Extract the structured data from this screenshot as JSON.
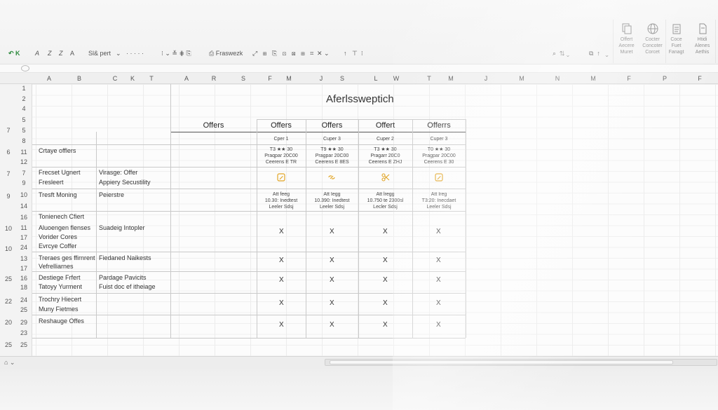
{
  "ribbon": {
    "groups": [
      {
        "label_top": "Offert",
        "label_mid": "Aecere",
        "label_bot": "Muret",
        "icon": "document-copy-icon"
      },
      {
        "label_top": "Cocter",
        "label_mid": "Concoter",
        "label_bot": "Corcet",
        "icon": "globe-icon"
      },
      {
        "label_top": "Coce",
        "label_mid": "Fuet",
        "label_bot": "Fanagt",
        "icon": "clipboard-icon"
      },
      {
        "label_top": "Htidi",
        "label_mid": "Alenes",
        "label_bot": "Aethis",
        "icon": "page-icon"
      }
    ]
  },
  "toolbar": {
    "undo": "↶ K",
    "font_a": "A",
    "font_z1": "Z",
    "font_z2": "Z",
    "font_b": "A",
    "font_name": "Sl& pert",
    "dots": "· · · · ·",
    "freeze": "Fraswezk",
    "colors": {
      "green": "#2e8b3e"
    }
  },
  "columns": [
    "A",
    "B",
    "C",
    "K",
    "T",
    "A",
    "R",
    "S",
    "F",
    "M",
    "J",
    "S",
    "L",
    "W",
    "T",
    "M",
    "J",
    "M",
    "N",
    "M",
    "F",
    "P",
    "F"
  ],
  "title": "Aferlsswep​tich",
  "table": {
    "header_left": "Offers",
    "headers": [
      "Offers",
      "Offers",
      "Offert",
      "Offerrs"
    ],
    "subheaders": [
      "Cper 1",
      "Cuper 3",
      "Cuper 2",
      "Cuper 3"
    ],
    "ratings": [
      {
        "l1": "T3 ★★ 30",
        "l2": "Praqpar 20C00",
        "l3": "Ceerens E TR"
      },
      {
        "l1": "T9 ★★ 30",
        "l2": "Pragpar 20C00",
        "l3": "Ceerens E 8ES"
      },
      {
        "l1": "T3 ★★ 30",
        "l2": "Pragarr 20C0",
        "l3": "Ceerens E ZHJ"
      },
      {
        "l1": "T0 ★★ 30",
        "l2": "Pragpar 20C00",
        "l3": "Ceerens E 30"
      }
    ],
    "icons": [
      "edit-icon",
      "link-icon",
      "scissors-icon",
      "edit-icon"
    ],
    "details": [
      {
        "l1": "Att feeg",
        "l2": "10.30: Inedtest",
        "l3": "Leeler Sdsj"
      },
      {
        "l1": "Att Iegg",
        "l2": "10.390: Inedtest",
        "l3": "Leeler Sdsj"
      },
      {
        "l1": "Att lregg",
        "l2": "10.750 te 2300sl",
        "l3": "Lecler Sdsj"
      },
      {
        "l1": "Att Ireg",
        "l2": "T3:20: Inecdaet",
        "l3": "Leeler Sdsj"
      }
    ],
    "x_mark": "X",
    "rows": [
      {
        "a": "Crtaye offlers",
        "c": ""
      },
      {
        "a": "Frecset Ugnert",
        "c": "Virasge: Offer"
      },
      {
        "a": "Fresleert",
        "c": "Appiery Secustility"
      },
      {
        "a": "Tresft Moning",
        "c": "Peierstre"
      },
      {
        "a": "Tonienech Cfiert",
        "c": ""
      },
      {
        "a": "Aluoengen flenses",
        "c": "Suadeig Intopler"
      },
      {
        "a": "Vorider Cores",
        "c": ""
      },
      {
        "a": "Evrcye Coffer",
        "c": ""
      },
      {
        "a": "Treraes ges ffirnrent",
        "c": "Fiedaned Naikests"
      },
      {
        "a": "Vefrelliarnes",
        "c": ""
      },
      {
        "a": "Destiege Frfert",
        "c": "Pardage Pavicits"
      },
      {
        "a": "Tatoyy Yurment",
        "c": "Fuist doc ef itheiage"
      },
      {
        "a": "Trochry Hiecert",
        "c": ""
      },
      {
        "a": "Muny Fietmes",
        "c": ""
      },
      {
        "a": "Reshauge Offes",
        "c": ""
      }
    ]
  },
  "row_numbers": {
    "outer": [
      "7",
      "6",
      "7",
      "9",
      "10",
      "10",
      "25",
      "22",
      "20",
      "25"
    ],
    "inner": [
      "1",
      "2",
      "4",
      "5",
      "8",
      "11",
      "12",
      "7",
      "9",
      "10",
      "14",
      "16",
      "11",
      "17",
      "24",
      "13",
      "25",
      "16",
      "18",
      "24",
      "25",
      "29",
      "23"
    ]
  },
  "bottom": {
    "sheet_tab": "⌂  ⌄"
  }
}
